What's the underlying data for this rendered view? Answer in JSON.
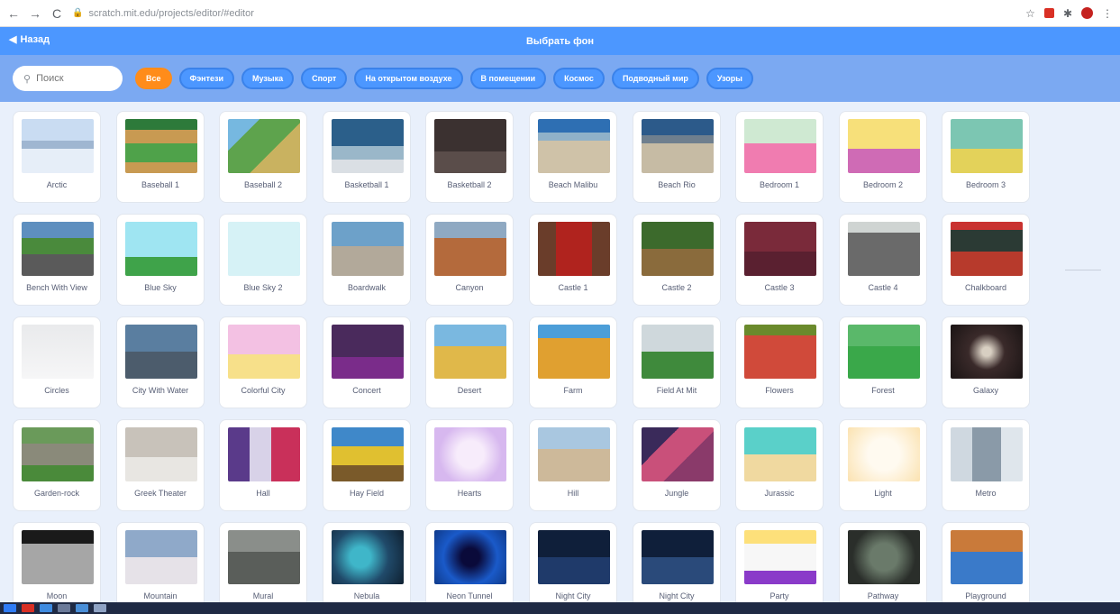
{
  "browser": {
    "back": "←",
    "forward": "→",
    "reload": "C",
    "url": "scratch.mit.edu/projects/editor/#editor",
    "star": "☆"
  },
  "header": {
    "back_label": "Назад",
    "title": "Выбрать фон"
  },
  "search": {
    "placeholder": "Поиск"
  },
  "tags": [
    "Все",
    "Фэнтези",
    "Музыка",
    "Спорт",
    "На открытом воздухе",
    "В помещении",
    "Космос",
    "Подводный мир",
    "Узоры"
  ],
  "backdrops": [
    "Arctic",
    "Baseball 1",
    "Baseball 2",
    "Basketball 1",
    "Basketball 2",
    "Beach Malibu",
    "Beach Rio",
    "Bedroom 1",
    "Bedroom 2",
    "Bedroom 3",
    "Bench With View",
    "Blue Sky",
    "Blue Sky 2",
    "Boardwalk",
    "Canyon",
    "Castle 1",
    "Castle 2",
    "Castle 3",
    "Castle 4",
    "Chalkboard",
    "Circles",
    "City With Water",
    "Colorful City",
    "Concert",
    "Desert",
    "Farm",
    "Field At Mit",
    "Flowers",
    "Forest",
    "Galaxy",
    "Garden-rock",
    "Greek Theater",
    "Hall",
    "Hay Field",
    "Hearts",
    "Hill",
    "Jungle",
    "Jurassic",
    "Light",
    "Metro",
    "Moon",
    "Mountain",
    "Mural",
    "Nebula",
    "Neon Tunnel",
    "Night City",
    "Night City",
    "Party",
    "Pathway",
    "Playground"
  ],
  "colors": {
    "header": "#4c97ff",
    "filter_bar": "#7ba9f2",
    "active_tag": "#ff8c1a"
  }
}
